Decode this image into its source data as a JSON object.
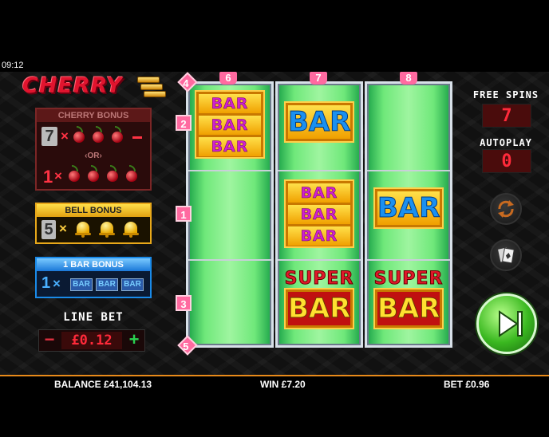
{
  "status": {
    "time": "09:12"
  },
  "logo": {
    "text": "CHERRY"
  },
  "cherry_bonus": {
    "title": "CHERRY BONUS",
    "count_top": "7",
    "times": "×",
    "or_text": "‹OR›",
    "count_bottom": "1"
  },
  "bell_bonus": {
    "title": "BELL BONUS",
    "count": "5",
    "times": "×"
  },
  "bar_bonus": {
    "title": "1 BAR BONUS",
    "count": "1",
    "times": "×",
    "bar_label": "BAR"
  },
  "line_bet": {
    "label": "LINE BET",
    "value": "£0.12",
    "minus": "−",
    "plus": "+"
  },
  "reels": {
    "bar_text": "BAR",
    "super_text": "SUPER",
    "top_tags": [
      "6",
      "7",
      "8"
    ],
    "left_markers": [
      "4",
      "2",
      "1",
      "3",
      "5"
    ]
  },
  "right_panel": {
    "free_spins_label": "FREE SPINS",
    "free_spins_value": "7",
    "autoplay_label": "AUTOPLAY",
    "autoplay_value": "0"
  },
  "footer": {
    "balance": "BALANCE £41,104.13",
    "win": "WIN £7.20",
    "bet": "BET £0.96"
  },
  "colors": {
    "accent_orange": "#e88a1a",
    "reel_green": "#6fe87a",
    "counter_red": "#ff2a3a"
  }
}
